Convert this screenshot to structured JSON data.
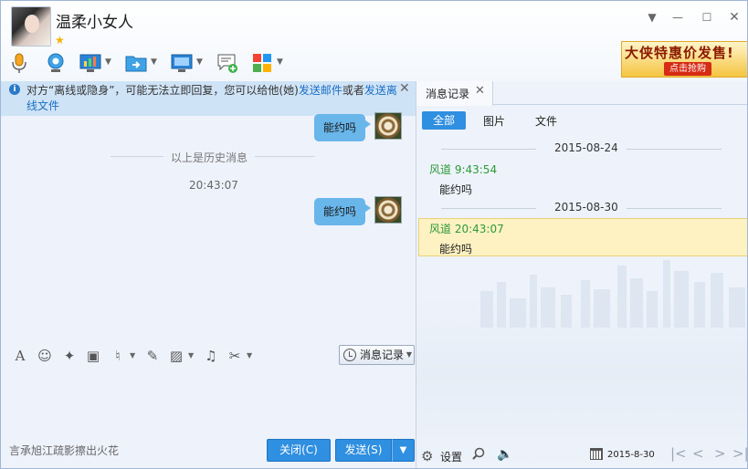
{
  "header": {
    "contact_name": "温柔小女人",
    "star": "★",
    "window_controls": {
      "menu": "▼",
      "minimize": "—",
      "maximize": "☐",
      "close": "✕"
    }
  },
  "ad": {
    "title": "大侠特惠价发售!",
    "button": "点击抢购"
  },
  "notice": {
    "text_prefix": "对方“离线或隐身”，可能无法立即回复，您可以给他(她)",
    "link_email": "发送邮件",
    "text_or": "或者",
    "link_offline_part1": "发送离",
    "link_offline_part2": "线文件",
    "close": "✕"
  },
  "chat": {
    "messages": [
      {
        "text": "能约吗"
      },
      {
        "text": "能约吗"
      }
    ],
    "history_divider": "以上是历史消息",
    "timestamp": "20:43:07"
  },
  "input_toolbar": {
    "font_glyph": "A",
    "history_button": "消息记录"
  },
  "bottom": {
    "signature": "言承旭江疏影擦出火花",
    "close_label": "关闭(C)",
    "send_label": "发送(S)"
  },
  "right_panel": {
    "tab_label": "消息记录",
    "tab_close": "✕",
    "filters": {
      "all": "全部",
      "pictures": "图片",
      "files": "文件"
    },
    "records": [
      {
        "date": "2015-08-24",
        "sender_time": "风道 9:43:54",
        "message": "能约吗"
      },
      {
        "date": "2015-08-30",
        "sender_time": "风道 20:43:07",
        "message": "能约吗"
      }
    ],
    "footer": {
      "settings_label": "设置",
      "date": "2015-8-30"
    }
  },
  "colors": {
    "accent_blue": "#2f8fe0",
    "bubble_blue": "#69b6ea",
    "notice_bg": "#cfe3f6",
    "sender_green": "#2b9a3a",
    "highlight_bg": "#fff2c2"
  }
}
